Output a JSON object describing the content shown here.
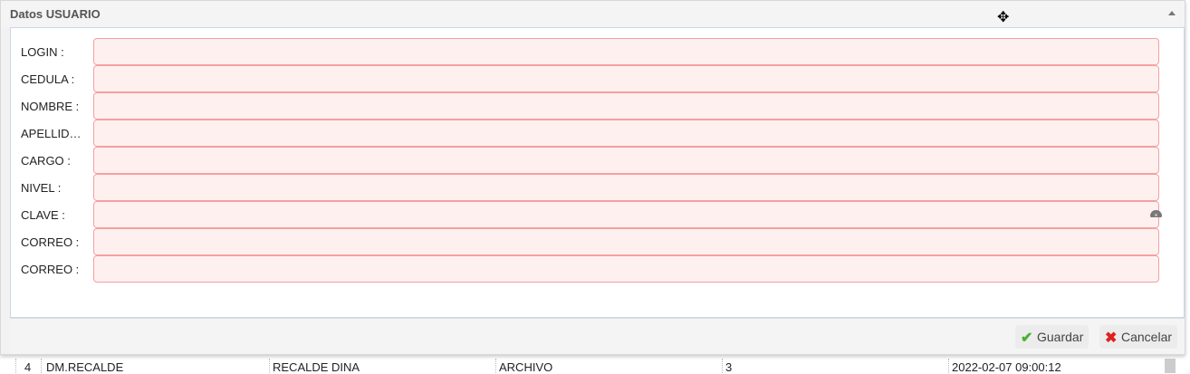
{
  "panel": {
    "title": "Datos USUARIO"
  },
  "fields": [
    {
      "label": "LOGIN :",
      "value": ""
    },
    {
      "label": "CEDULA :",
      "value": ""
    },
    {
      "label": "NOMBRE :",
      "value": ""
    },
    {
      "label": "APELLIDOS :",
      "value": ""
    },
    {
      "label": "CARGO :",
      "value": ""
    },
    {
      "label": "NIVEL :",
      "value": ""
    },
    {
      "label": "CLAVE :",
      "value": ""
    },
    {
      "label": "CORREO :",
      "value": ""
    },
    {
      "label": "CORREO :",
      "value": ""
    }
  ],
  "footer": {
    "save": "Guardar",
    "cancel": "Cancelar"
  },
  "table_row": {
    "num": "4",
    "login": "DM.RECALDE",
    "nombre": "RECALDE DINA",
    "cargo": "ARCHIVO",
    "nivel": "3",
    "fecha": "2022-02-07 09:00:12"
  }
}
